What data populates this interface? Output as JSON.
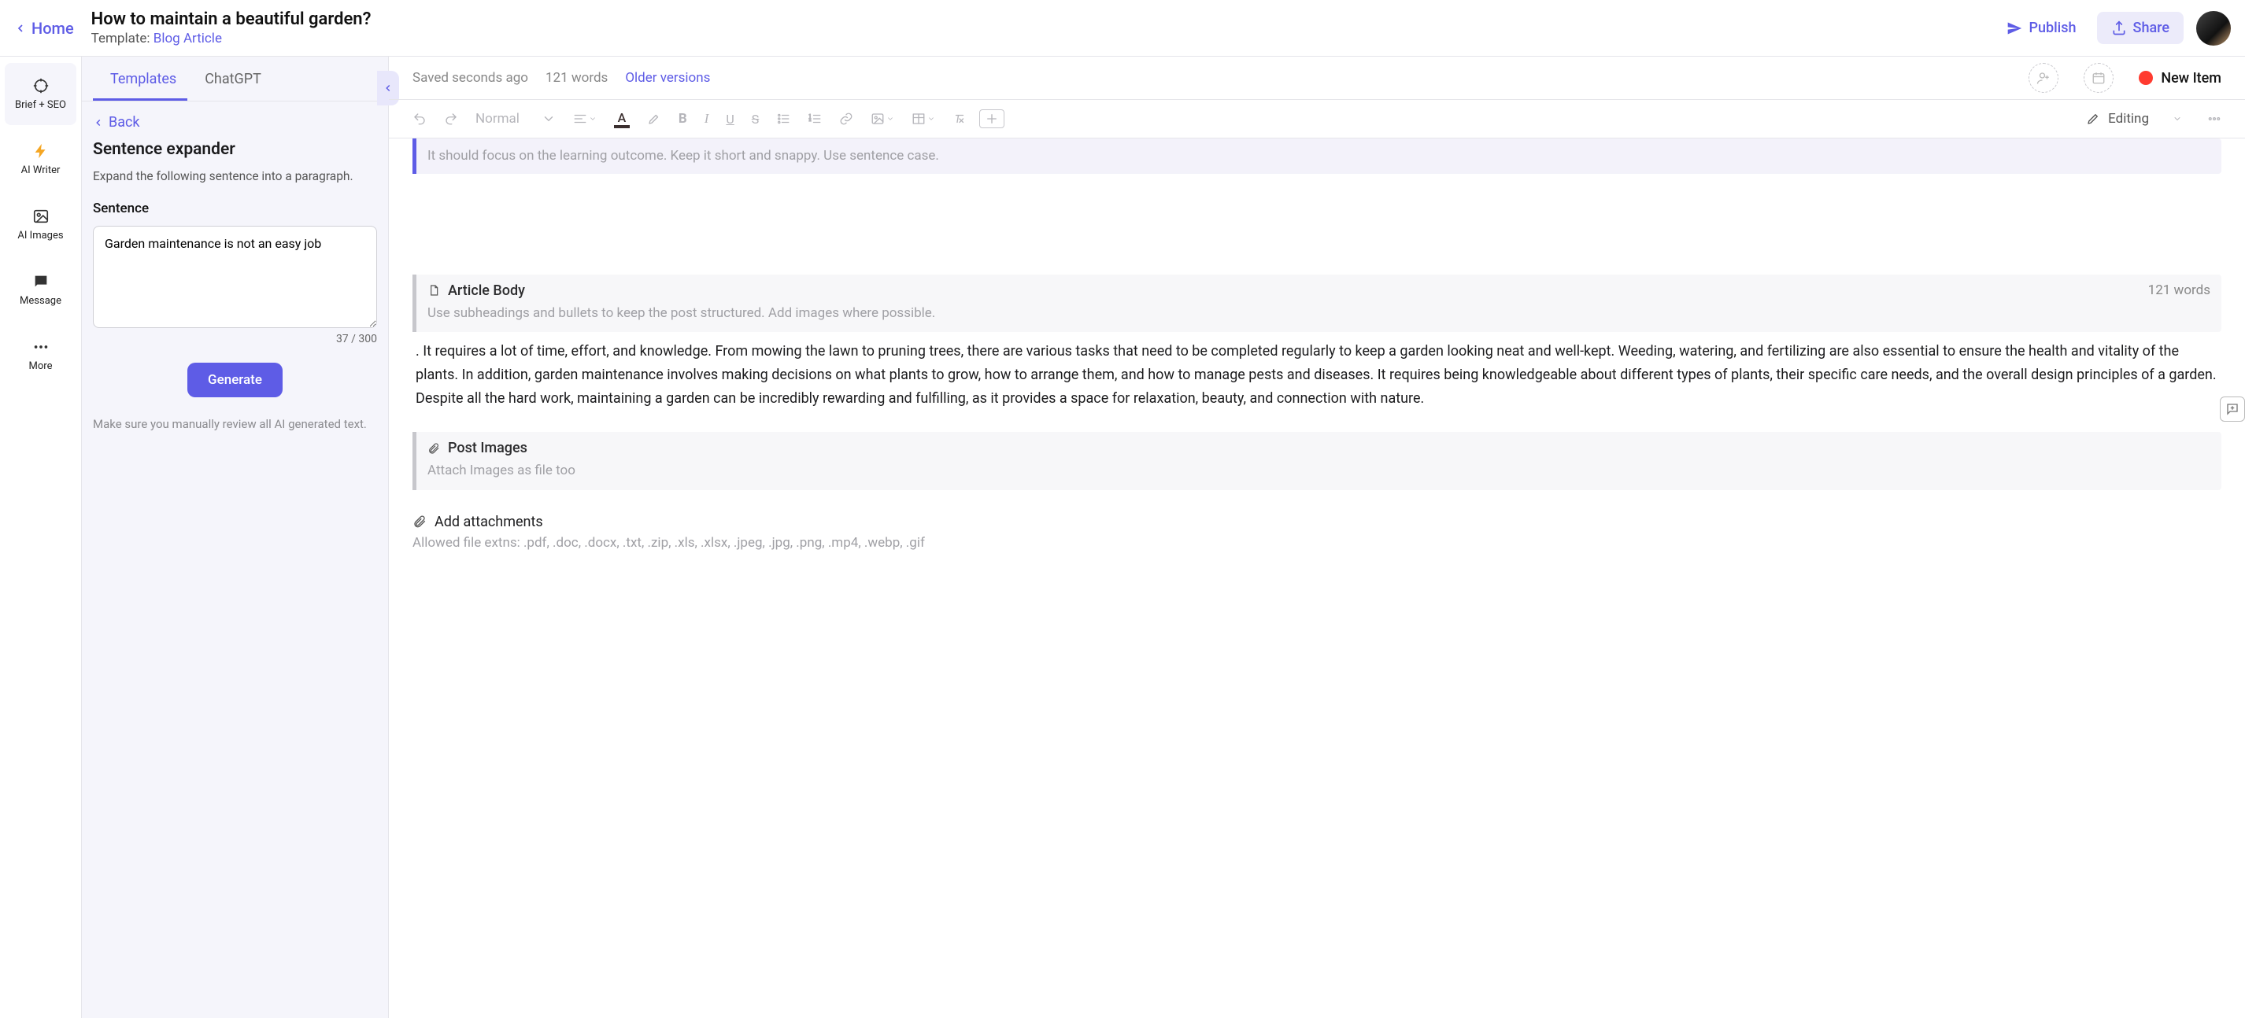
{
  "header": {
    "home": "Home",
    "title": "How to maintain a beautiful garden?",
    "template_label": "Template: ",
    "template_name": "Blog Article",
    "publish": "Publish",
    "share": "Share"
  },
  "rail": {
    "items": [
      {
        "key": "brief",
        "label": "Brief + SEO"
      },
      {
        "key": "writer",
        "label": "AI Writer"
      },
      {
        "key": "images",
        "label": "AI Images"
      },
      {
        "key": "message",
        "label": "Message"
      },
      {
        "key": "more",
        "label": "More"
      }
    ]
  },
  "panel": {
    "tabs": {
      "templates": "Templates",
      "chatgpt": "ChatGPT"
    },
    "back": "Back",
    "tool_title": "Sentence expander",
    "tool_sub": "Expand the following sentence into a paragraph.",
    "field_label": "Sentence",
    "sentence_value": "Garden maintenance is not an easy job",
    "counter": "37 / 300",
    "generate": "Generate",
    "disclaimer": "Make sure you manually review all AI generated text."
  },
  "status": {
    "saved": "Saved seconds ago",
    "words": "121 words",
    "older": "Older versions",
    "new_item": "New Item"
  },
  "toolbar": {
    "para_style": "Normal",
    "editing_mode": "Editing"
  },
  "doc": {
    "top_hint": "It should focus on the learning outcome. Keep it short and snappy. Use sentence case.",
    "body_heading": "Article Body",
    "body_words": "121 words",
    "body_hint": "Use subheadings and bullets to keep the post structured. Add images where possible.",
    "body_text": ". It requires a lot of time, effort, and knowledge. From mowing the lawn to pruning trees, there are various tasks that need to be completed regularly to keep a garden looking neat and well-kept. Weeding, watering, and fertilizing are also essential to ensure the health and vitality of the plants. In addition, garden maintenance involves making decisions on what plants to grow, how to arrange them, and how to manage pests and diseases. It requires being knowledgeable about different types of plants, their specific care needs, and the overall design principles of a garden. Despite all the hard work, maintaining a garden can be incredibly rewarding and fulfilling, as it provides a space for relaxation, beauty, and connection with nature.",
    "images_heading": "Post Images",
    "images_hint": "Attach Images as file too",
    "attach_label": "Add attachments",
    "attach_hint": "Allowed file extns: .pdf, .doc, .docx, .txt, .zip, .xls, .xlsx, .jpeg, .jpg, .png, .mp4, .webp, .gif"
  }
}
